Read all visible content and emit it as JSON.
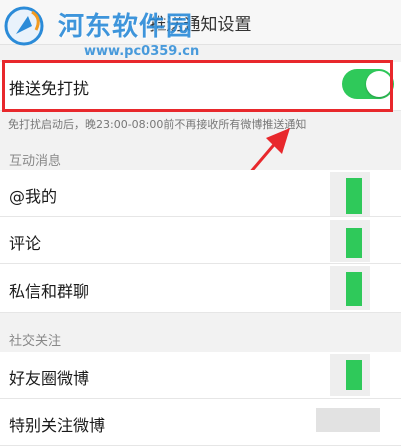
{
  "header": {
    "back_icon": "chevron-left-icon",
    "title": "推送通知设置"
  },
  "watermark": {
    "logo": "logo-icon",
    "name": "河东软件园",
    "url": "www.pc0359.cn"
  },
  "dnd": {
    "label": "推送免打扰",
    "toggle_on": true,
    "hint": "免打扰启动后，晚23:00-08:00前不再接收所有微博推送通知"
  },
  "sections": [
    {
      "title": "互动消息",
      "items": [
        "@我的",
        "评论",
        "私信和群聊"
      ]
    },
    {
      "title": "社交关注",
      "items": [
        "好友圈微博",
        "特别关注微博"
      ]
    }
  ],
  "colors": {
    "toggle_on": "#2fc95a",
    "highlight": "#e8282c",
    "watermark": "#2b8bd8"
  }
}
